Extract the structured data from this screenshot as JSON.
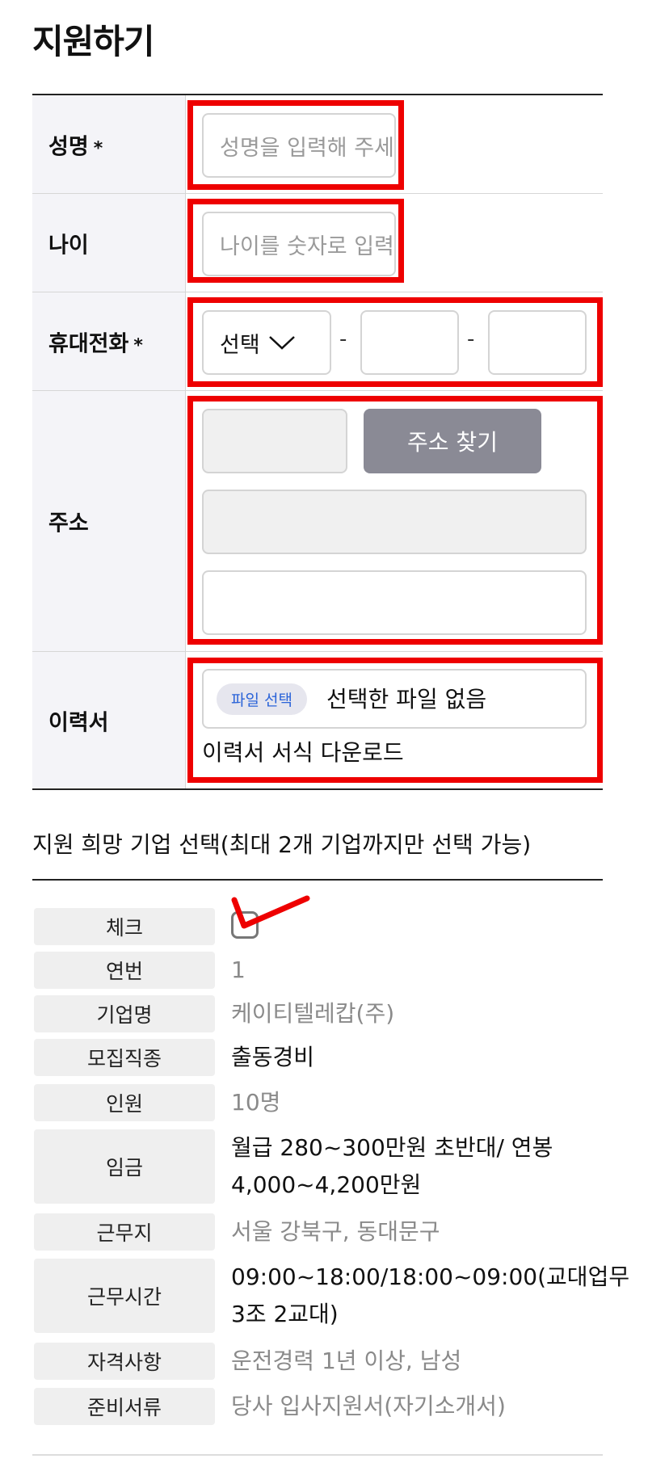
{
  "page": {
    "title": "지원하기"
  },
  "form": {
    "name": {
      "label": "성명",
      "required_mark": "*",
      "placeholder": "성명을 입력해 주세요"
    },
    "age": {
      "label": "나이",
      "placeholder": "나이를 숫자로 입력해 주세요"
    },
    "phone": {
      "label": "휴대전화",
      "required_mark": "*",
      "select_value": "선택",
      "dash": "-"
    },
    "address": {
      "label": "주소",
      "search_button": "주소 찾기"
    },
    "resume": {
      "label": "이력서",
      "file_button": "파일 선택",
      "file_status": "선택한 파일 없음",
      "download_link": "이력서 서식 다운로드"
    }
  },
  "company_section": {
    "heading": "지원 희망 기업 선택(최대 2개 기업까지만 선택 가능)",
    "labels": {
      "check": "체크",
      "no": "연번",
      "company": "기업명",
      "job": "모집직종",
      "people": "인원",
      "wage": "임금",
      "location": "근무지",
      "hours": "근무시간",
      "qualification": "자격사항",
      "documents": "준비서류"
    },
    "values": {
      "no": "1",
      "company": "케이티텔레캅(주)",
      "job": "출동경비",
      "people": "10명",
      "wage_line1": "월급 280~300만원 초반대/ 연봉",
      "wage_line2": "4,000~4,200만원",
      "location": "서울 강북구, 동대문구",
      "hours_line1": "09:00~18:00/18:00~09:00(교대업무",
      "hours_line2": "3조 2교대)",
      "qualification": "운전경력 1년 이상, 남성",
      "documents": "당사 입사지원서(자기소개서)"
    }
  },
  "colors": {
    "highlight": "#ee0000",
    "label_bg": "#f4f4f8",
    "button_gray": "#8a8a95",
    "file_button_text": "#2a63d8"
  },
  "icons": {
    "select_chevron": "chevron-down-icon",
    "checkmark_annotation": "red-checkmark-icon"
  }
}
